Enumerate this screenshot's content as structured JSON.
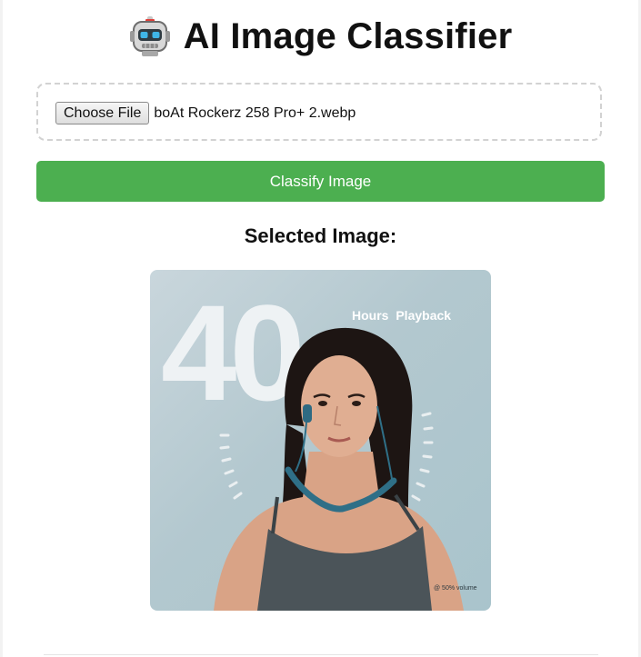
{
  "header": {
    "icon": "robot-icon",
    "title": "AI Image Classifier"
  },
  "upload": {
    "button_label": "Choose File",
    "file_name": "boAt Rockerz 258 Pro+ 2.webp"
  },
  "classify": {
    "button_label": "Classify Image",
    "color": "#4caf50"
  },
  "preview": {
    "heading": "Selected Image:",
    "overlay_number": "40",
    "overlay_label": "Hours Playback",
    "footnote": "@ 50% volume"
  }
}
